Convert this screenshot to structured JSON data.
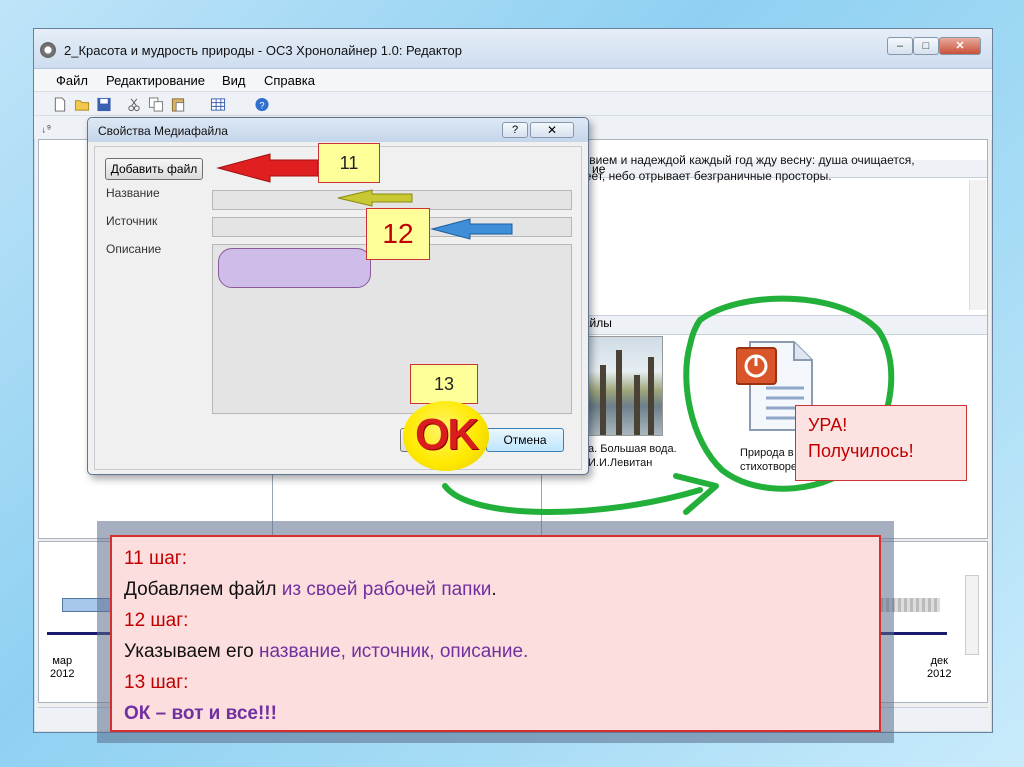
{
  "window": {
    "title": "2_Красота и мудрость природы - ОС3 Хронолайнер 1.0: Редактор",
    "controls": {
      "minimize": "–",
      "maximize": "□",
      "close": "✕"
    }
  },
  "menu": [
    "Файл",
    "Редактирование",
    "Вид",
    "Справка"
  ],
  "description_panel": {
    "header": "ие",
    "text": "пльствием и надеждой каждый год жду весну: душа очищается, свежеет, небо отрывает безграничные просторы."
  },
  "files_panel": {
    "header": "файлы",
    "painting_caption": "а. Большая вода. И.И.Левитан",
    "document_caption": "Природа в стихотворениях р"
  },
  "timeline": {
    "left_date": [
      "мар",
      "2012"
    ],
    "right_date": [
      "дек",
      "2012"
    ]
  },
  "dialog": {
    "title": "Свойства Медиафайла",
    "help": "?",
    "close": "✕",
    "add_file_button": "Добавить файл",
    "name_label": "Название",
    "source_label": "Источник",
    "description_label": "Описание",
    "cancel_button": "Отмена"
  },
  "annotations": {
    "step11": "11",
    "step12": "12",
    "step13": "13",
    "ok_badge": "OK",
    "success": [
      "УРА!",
      "Получилось!"
    ],
    "arrow_colors": {
      "red": "#e02020",
      "yellow": "#c8c832",
      "blue": "#3e8ed8",
      "green": "#22b03a"
    }
  },
  "instructions": {
    "l1": "11 шаг:",
    "l2a": "Добавляем файл ",
    "l2b": "из своей рабочей папки",
    "l2c": ".",
    "l3": "12 шаг:",
    "l4a": "Указываем его ",
    "l4b": "название, источник, описание.",
    "l5": "13 шаг:",
    "l6": "ОК – вот и все!!!"
  }
}
